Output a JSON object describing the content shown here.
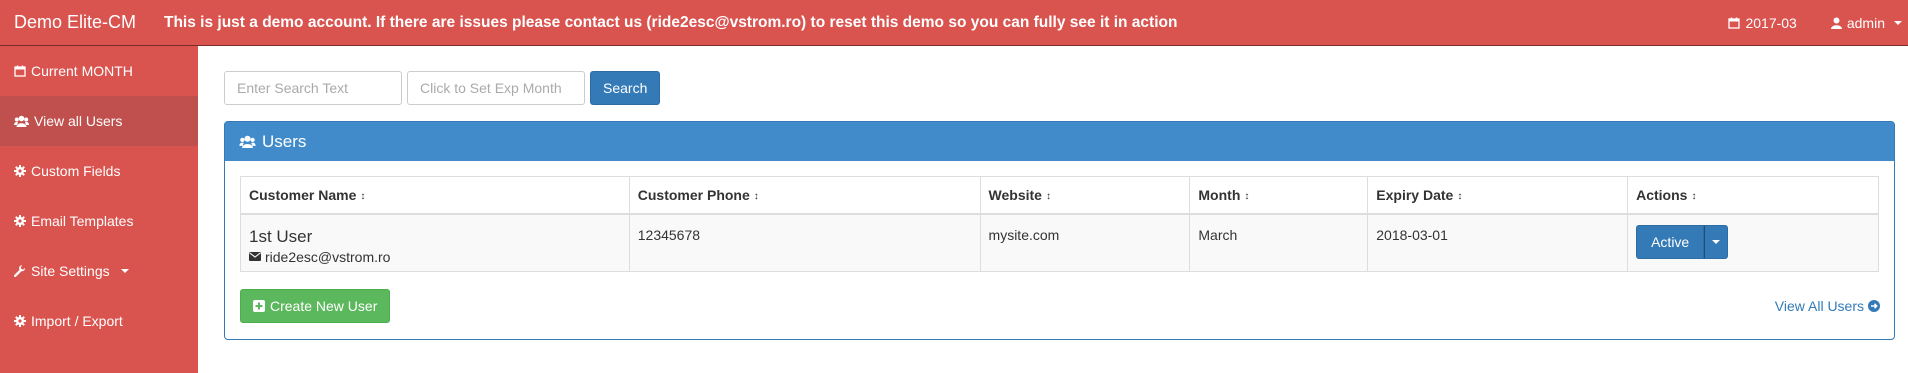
{
  "topbar": {
    "brand": "Demo Elite-CM",
    "notice": "This is just a demo account. If there are issues please contact us (ride2esc@vstrom.ro) to reset this demo so you can fully see it in action",
    "month": "2017-03",
    "user": "admin"
  },
  "sidebar": {
    "items": [
      {
        "label": "Current MONTH",
        "icon": "calendar-icon"
      },
      {
        "label": "View all Users",
        "icon": "users-icon"
      },
      {
        "label": "Custom Fields",
        "icon": "gear-icon"
      },
      {
        "label": "Email Templates",
        "icon": "gear-icon"
      },
      {
        "label": "Site Settings",
        "icon": "wrench-icon"
      },
      {
        "label": "Import / Export",
        "icon": "gear-icon"
      }
    ]
  },
  "search": {
    "text_placeholder": "Enter Search Text",
    "month_placeholder": "Click to Set Exp Month",
    "button": "Search"
  },
  "panel": {
    "title": "Users",
    "columns": [
      "Customer Name",
      "Customer Phone",
      "Website",
      "Month",
      "Expiry Date",
      "Actions"
    ],
    "rows": [
      {
        "name": "1st User",
        "email": "ride2esc@vstrom.ro",
        "phone": "12345678",
        "website": "mysite.com",
        "month": "March",
        "expiry": "2018-03-01",
        "action": "Active"
      }
    ],
    "create_button": "Create New User",
    "view_all": "View All Users"
  },
  "colors": {
    "brand_red": "#d9534f",
    "primary_blue": "#337ab7",
    "success_green": "#5cb85c"
  }
}
